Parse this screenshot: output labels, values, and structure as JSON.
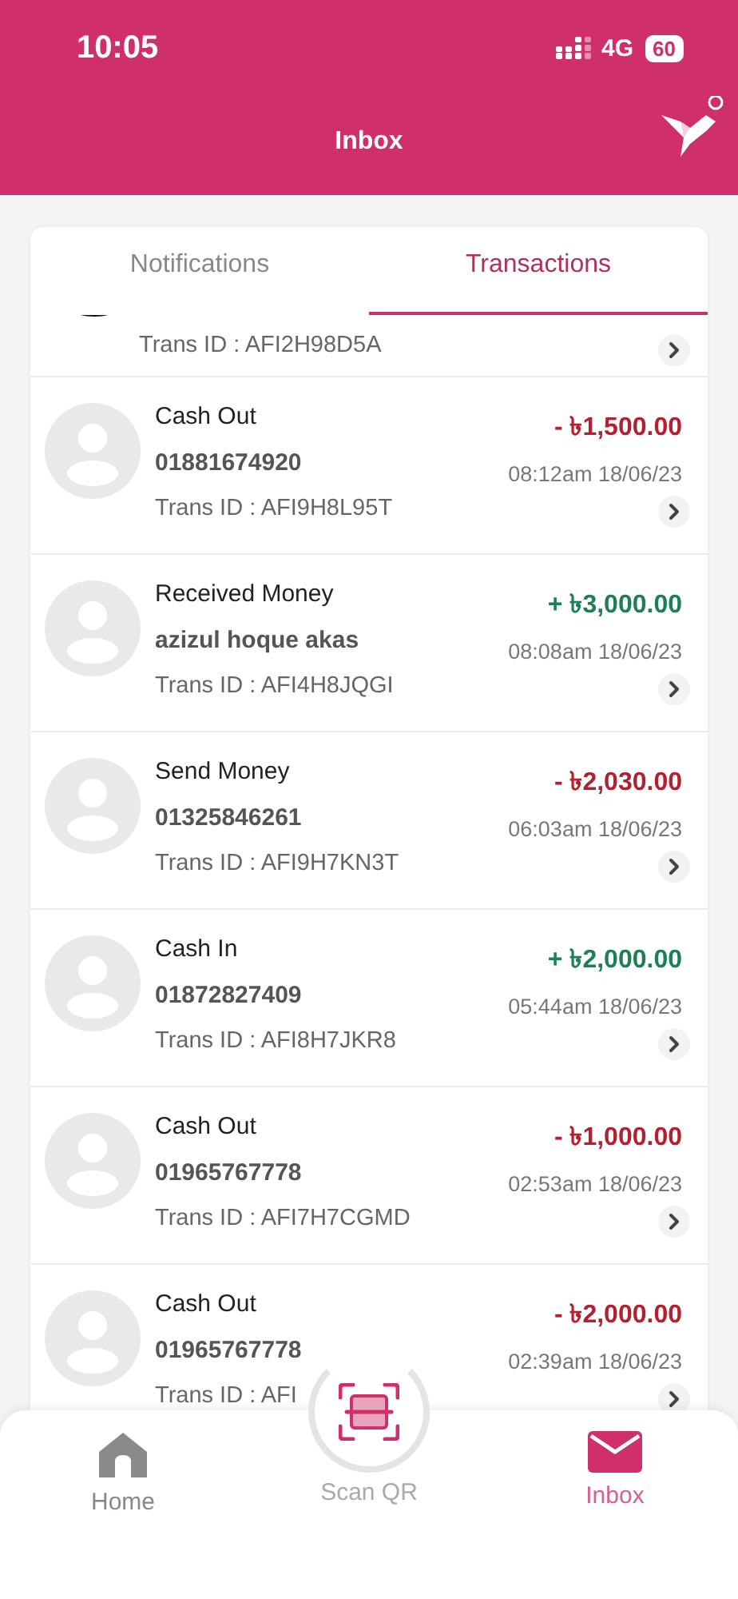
{
  "status_bar": {
    "time": "10:05",
    "network": "4G",
    "battery": "60"
  },
  "header": {
    "title": "Inbox"
  },
  "tabs": [
    {
      "label": "Notifications",
      "selected": false
    },
    {
      "label": "Transactions",
      "selected": true
    }
  ],
  "transactions": [
    {
      "kind": "partial",
      "trans_id": "Trans ID : AFI2H98D5A"
    },
    {
      "kind": "full",
      "title": "Cash Out",
      "party": "01881674920",
      "trans_id": "Trans ID : AFI9H8L95T",
      "amount": "- ৳1,500.00",
      "color": "#b3202f",
      "time": "08:12am 18/06/23"
    },
    {
      "kind": "full",
      "title": "Received Money",
      "party": "azizul hoque akas",
      "trans_id": "Trans ID : AFI4H8JQGI",
      "amount": "+ ৳3,000.00",
      "color": "#1d7f53",
      "time": "08:08am 18/06/23"
    },
    {
      "kind": "full",
      "title": "Send Money",
      "party": "01325846261",
      "trans_id": "Trans ID : AFI9H7KN3T",
      "amount": "- ৳2,030.00",
      "color": "#b3202f",
      "time": "06:03am 18/06/23"
    },
    {
      "kind": "full",
      "title": "Cash In",
      "party": "01872827409",
      "trans_id": "Trans ID : AFI8H7JKR8",
      "amount": "+ ৳2,000.00",
      "color": "#1d7f53",
      "time": "05:44am 18/06/23"
    },
    {
      "kind": "full",
      "title": "Cash Out",
      "party": "01965767778",
      "trans_id": "Trans ID : AFI7H7CGMD",
      "amount": "- ৳1,000.00",
      "color": "#b3202f",
      "time": "02:53am 18/06/23"
    },
    {
      "kind": "full",
      "title": "Cash Out",
      "party": "01965767778",
      "trans_id": "Trans ID : AFI",
      "amount": "- ৳2,000.00",
      "color": "#b3202f",
      "time": "02:39am 18/06/23"
    }
  ],
  "bottom_nav": [
    {
      "kind": "home",
      "label": "Home",
      "selected": false
    },
    {
      "kind": "scan",
      "label": "Scan QR",
      "selected": false
    },
    {
      "kind": "inbox",
      "label": "Inbox",
      "selected": true
    }
  ]
}
